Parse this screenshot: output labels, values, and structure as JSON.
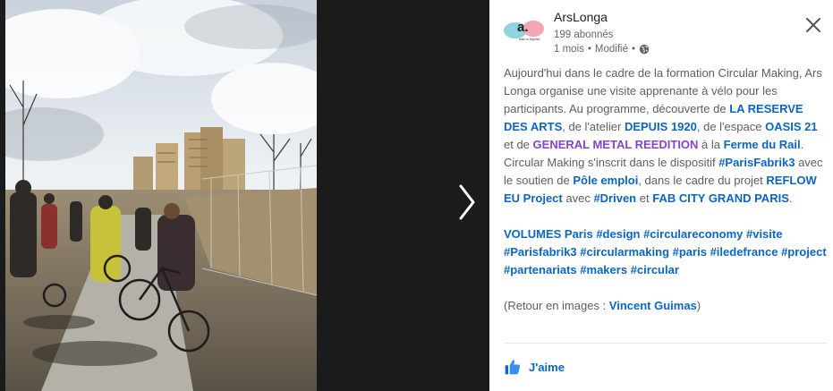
{
  "org": {
    "name": "ArsLonga",
    "followers": "199 abonnés",
    "time": "1 mois",
    "separator": "•",
    "edited": "Modifié",
    "avatar_letter": "a.",
    "avatar_tagline": "learn to inspired"
  },
  "post": {
    "l1_a": "Aujourd'hui dans le cadre de la formation Circular Making, Ars Longa organise une visite apprenante à vélo pour les participants. Au programme, découverte de ",
    "l1_link1": "LA RESERVE DES ARTS",
    "l1_b": ", de l'atelier ",
    "l1_link2": "DEPUIS 1920",
    "l1_c": ", de l'espace ",
    "l1_link3": "OASIS 21",
    "l1_d": " et de ",
    "l1_link4": "GENERAL METAL REEDITION",
    "l1_e": " à la ",
    "l1_link5": "Ferme du Rail",
    "l1_f": ". Circular Making s'inscrit dans le dispositif ",
    "l1_link6": "#ParisFabrik3",
    "l1_g": " avec le soutien de ",
    "l1_link7": "Pôle emploi",
    "l1_h": ", dans le cadre du projet ",
    "l1_link8": "REFLOW EU Project",
    "l1_i": " avec ",
    "l1_link9": "#Driven",
    "l1_j": " et ",
    "l1_link10": "FAB CITY GRAND PARIS",
    "l1_k": ".",
    "tags_lead": "VOLUMES Paris",
    "tags": [
      "#design",
      "#circulareconomy",
      "#visite",
      "#Parisfabrik3",
      "#circularmaking",
      "#paris",
      "#iledefrance",
      "#project",
      "#partenariats",
      "#makers",
      "#circular"
    ],
    "credit_a": "(Retour en images : ",
    "credit_link": "Vincent Guimas",
    "credit_b": ")"
  },
  "actions": {
    "like_label": "J'aime"
  },
  "colors": {
    "link": "#0a66c2",
    "visited_link": "#8344cc",
    "text": "#5e5e5e",
    "viewer_bg": "#1b1b1b"
  },
  "icons": {
    "close": "close-icon",
    "globe": "globe-icon",
    "next": "chevron-right-icon",
    "like": "thumbs-up-icon"
  }
}
